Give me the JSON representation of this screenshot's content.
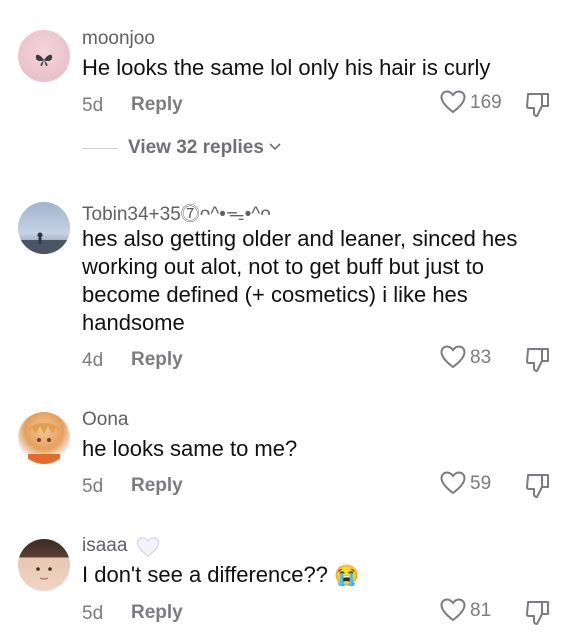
{
  "comments": [
    {
      "username": "moonjoo",
      "text": "He looks the same lol only his hair is curly",
      "date": "5d",
      "reply_label": "Reply",
      "likes": "169",
      "view_replies_label": "View 32 replies",
      "avatar_icon": "butterfly-icon"
    },
    {
      "username": "Tobin34+35⓻ᴖ^•ᯓ•^ᴖ",
      "text": "hes also getting older and leaner, sinced hes working out alot, not to get buff but just to become defined (+ cosmetics) i like hes handsome",
      "date": "4d",
      "reply_label": "Reply",
      "likes": "83",
      "avatar_icon": "sky-silhouette-icon"
    },
    {
      "username": "Oona",
      "text": "he looks same to me?",
      "date": "5d",
      "reply_label": "Reply",
      "likes": "59",
      "avatar_icon": "anime-character-icon"
    },
    {
      "username": "isaaa",
      "text": "I don't see a difference??",
      "text_emoji": "😭",
      "date": "5d",
      "reply_label": "Reply",
      "likes": "81",
      "avatar_icon": "person-photo-icon",
      "username_badge": "white-heart-icon"
    }
  ],
  "colors": {
    "username": "#5f5f66",
    "text": "#111111",
    "meta": "#7b7b82",
    "background": "#ffffff"
  }
}
